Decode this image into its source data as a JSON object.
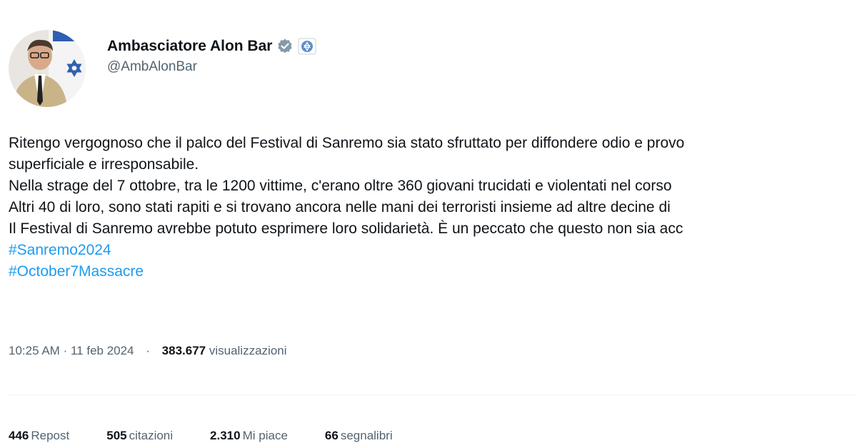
{
  "author": {
    "display_name": "Ambasciatore Alon Bar",
    "handle": "@AmbAlonBar",
    "verified_icon": "verified-badge-icon",
    "affiliate_icon": "government-affiliate-icon",
    "verified_color": "#829aab"
  },
  "tweet": {
    "lines": [
      "Ritengo vergognoso che il palco del Festival di Sanremo sia stato sfruttato per diffondere odio e provo",
      "superficiale e irresponsabile.",
      "Nella strage del 7 ottobre, tra le 1200 vittime, c'erano oltre 360 giovani trucidati e violentati nel corso",
      "Altri 40 di loro, sono stati rapiti e si trovano ancora nelle mani dei terroristi insieme ad altre decine di",
      "Il Festival di Sanremo avrebbe potuto esprimere loro solidarietà. È un peccato che questo non sia acc"
    ],
    "hashtags": [
      "#Sanremo2024",
      "#October7Massacre"
    ],
    "hashtag_color": "#1d9bf0"
  },
  "meta": {
    "time": "10:25 AM",
    "dot1": "·",
    "date": "11 feb 2024",
    "dot2": "·",
    "views_count": "383.677",
    "views_label": "visualizzazioni"
  },
  "stats": [
    {
      "count": "446",
      "label": "Repost"
    },
    {
      "count": "505",
      "label": "citazioni"
    },
    {
      "count": "2.310",
      "label": "Mi piace"
    },
    {
      "count": "66",
      "label": "segnalibri"
    }
  ]
}
